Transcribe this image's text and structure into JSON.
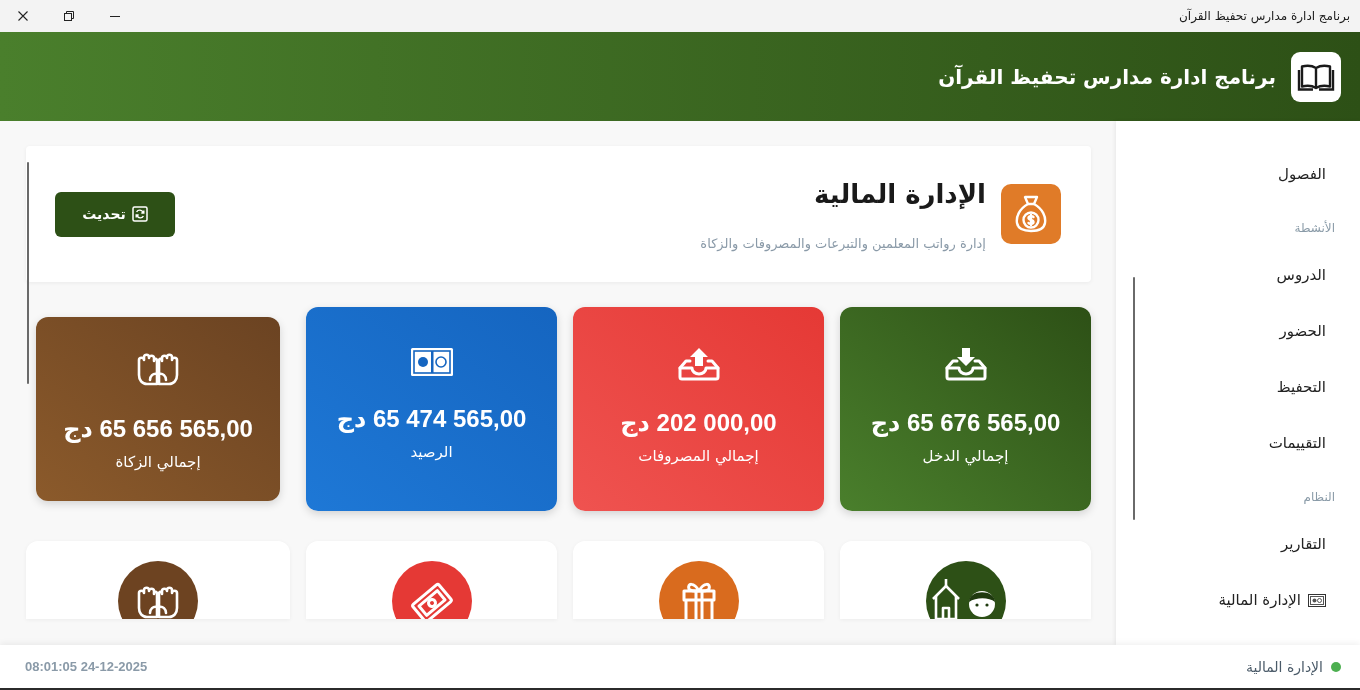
{
  "window": {
    "title": "برنامج ادارة مدارس تحفيظ القرآن"
  },
  "header": {
    "title": "برنامج ادارة مدارس تحفيظ القرآن"
  },
  "sidebar": {
    "groups": [
      {
        "items": [
          {
            "label": "الفصول",
            "kind": "plain",
            "selected": false
          }
        ]
      },
      {
        "label": "الأنشطة",
        "items": [
          {
            "label": "الدروس",
            "kind": "plain",
            "selected": false
          },
          {
            "label": "الحضور",
            "kind": "plain",
            "selected": false
          },
          {
            "label": "التحفيظ",
            "kind": "plain",
            "selected": false
          },
          {
            "label": "التقييمات",
            "kind": "plain",
            "selected": false
          }
        ]
      },
      {
        "label": "النظام",
        "items": [
          {
            "label": "التقارير",
            "kind": "plain",
            "selected": false
          },
          {
            "label": "الإدارة المالية",
            "kind": "with-icon",
            "selected": false
          }
        ]
      }
    ]
  },
  "page_header": {
    "title": "الإدارة المالية",
    "subtitle": "إدارة رواتب المعلمين والتبرعات والمصروفات والزكاة",
    "refresh_button": "تحديث"
  },
  "stats": [
    {
      "kind": "income",
      "amount": "65 676 565,00 دج",
      "label": "إجمالي الدخل"
    },
    {
      "kind": "expenses",
      "amount": "202 000,00 دج",
      "label": "إجمالي المصروفات"
    },
    {
      "kind": "balance",
      "amount": "65 474 565,00 دج",
      "label": "الرصيد"
    },
    {
      "kind": "zakat",
      "amount": "65 656 565,00 دج",
      "label": "إجمالي الزكاة"
    }
  ],
  "modules": [
    {
      "kind": "salaries"
    },
    {
      "kind": "donations"
    },
    {
      "kind": "expenses"
    },
    {
      "kind": "zakat"
    }
  ],
  "status_bar": {
    "page": "الإدارة المالية",
    "datetime": "08:01:05 24-12-2025"
  }
}
